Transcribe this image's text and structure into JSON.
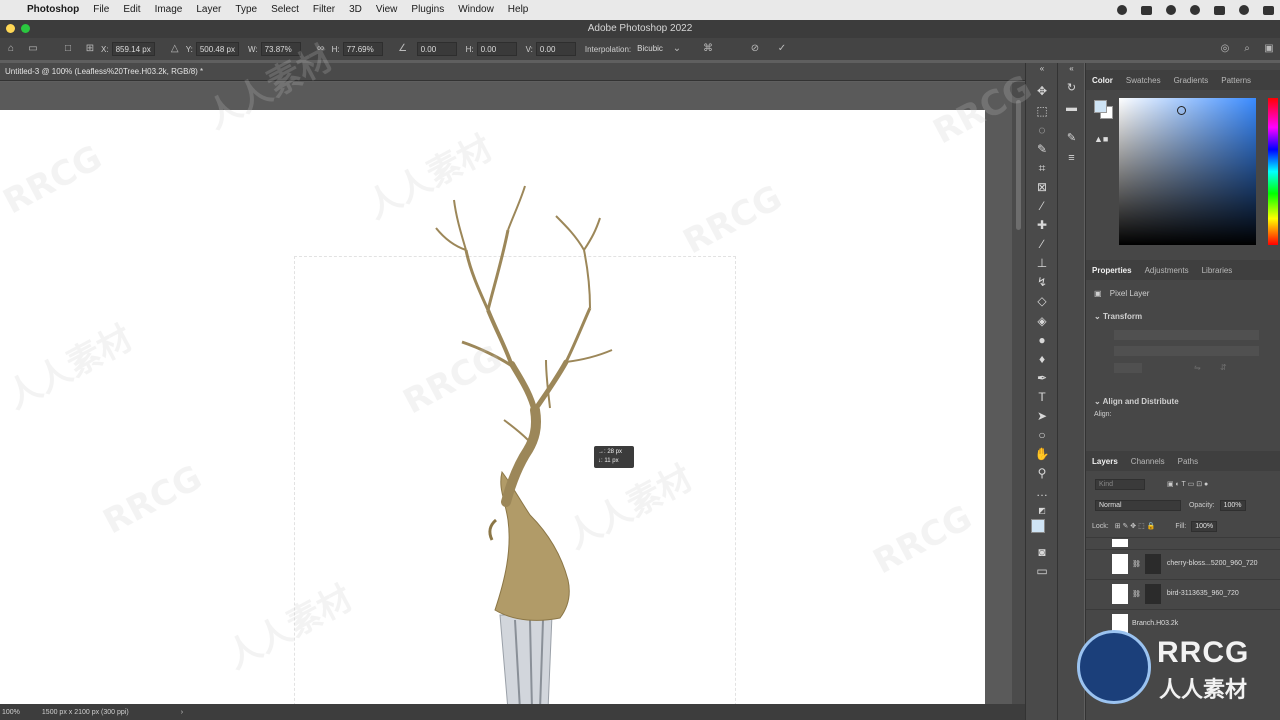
{
  "menubar": {
    "apple": "",
    "app": "Photoshop",
    "items": [
      "File",
      "Edit",
      "Image",
      "Layer",
      "Type",
      "Select",
      "Filter",
      "3D",
      "View",
      "Plugins",
      "Window",
      "Help"
    ]
  },
  "window_title": "Adobe Photoshop 2022",
  "options": {
    "x_label": "X:",
    "x_value": "859.14 px",
    "y_label": "Y:",
    "y_value": "500.48 px",
    "w_label": "W:",
    "w_value": "73.87%",
    "h_label": "H:",
    "h_value": "77.69%",
    "angle_value": "0.00",
    "hskew_label": "H:",
    "hskew_value": "0.00",
    "vskew_label": "V:",
    "vskew_value": "0.00",
    "interp_label": "Interpolation:",
    "interp_value": "Bicubic"
  },
  "document": {
    "tab_title": "Untitled-3 @ 100% (Leafless%20Tree.H03.2k, RGB/8) *",
    "tooltip_line1": "→: 28 px",
    "tooltip_line2": "↓: 11 px"
  },
  "status": {
    "zoom": "100%",
    "dimensions": "1500 px x 2100 px (300 ppi)",
    "arrow": "›"
  },
  "panels": {
    "color_tabs": [
      "Color",
      "Swatches",
      "Gradients",
      "Patterns"
    ],
    "props_tabs": [
      "Properties",
      "Adjustments",
      "Libraries"
    ],
    "pixel_layer": "Pixel Layer",
    "transform": "Transform",
    "align": "Align and Distribute",
    "align_label": "Align:",
    "layers_tabs": [
      "Layers",
      "Channels",
      "Paths"
    ],
    "kind_placeholder": "Kind",
    "blend_mode": "Normal",
    "opacity_label": "Opacity:",
    "opacity_value": "100%",
    "lock_label": "Lock:",
    "fill_label": "Fill:",
    "fill_value": "100%",
    "layers": [
      {
        "name": "cherry-bloss...5200_960_720"
      },
      {
        "name": "bird-3113635_960_720"
      },
      {
        "name": "Branch.H03.2k"
      }
    ]
  },
  "watermarks": [
    "RRCG",
    "人人素材",
    "RRCG",
    "人人素材",
    "RRCG",
    "人人素材",
    "RRCG",
    "人人素材",
    "RRCG",
    "RRCG",
    "人人素材"
  ],
  "logo": {
    "text1": "RRCG",
    "text2": "人人素材"
  },
  "colors": {
    "accent": "#3a8bff",
    "menubar": "#e9e9e9",
    "panel": "#474747"
  }
}
